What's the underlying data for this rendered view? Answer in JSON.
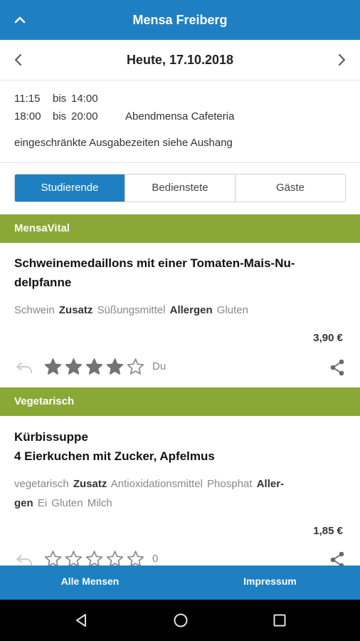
{
  "header": {
    "title": "Mensa Freiberg",
    "collapse_icon": "chevron-up-icon"
  },
  "datebar": {
    "date": "Heute, 17.10.2018",
    "prev_icon": "chevron-left-icon",
    "next_icon": "chevron-right-icon"
  },
  "hours": {
    "rows": [
      {
        "from": "11:15",
        "sep": "bis",
        "to": "14:00",
        "label": ""
      },
      {
        "from": "18:00",
        "sep": "bis",
        "to": "20:00",
        "label": "Abendmensa Cafeteria"
      }
    ],
    "notice": "eingeschränkte Ausgabezeiten siehe Aushang"
  },
  "tabs": [
    {
      "label": "Studierende",
      "active": true
    },
    {
      "label": "Bedienstete",
      "active": false
    },
    {
      "label": "Gäste",
      "active": false
    }
  ],
  "meals": [
    {
      "category": "MensaVital",
      "title_lines": [
        "Schweinemedaillons mit einer Tomaten-Mais-Nu-",
        "delpfanne"
      ],
      "tag_lines": [
        [
          {
            "text": "Schwein",
            "bold": false
          },
          {
            "text": "Zusatz",
            "bold": true
          },
          {
            "text": "Süßungsmittel",
            "bold": false
          },
          {
            "text": "Allergen",
            "bold": true
          },
          {
            "text": "Gluten",
            "bold": false
          }
        ]
      ],
      "price": "3,90 €",
      "rating": {
        "stars": 4,
        "max": 5,
        "label": "Du"
      }
    },
    {
      "category": "Vegetarisch",
      "title_lines": [
        "Kürbissuppe",
        "4 Eierkuchen mit Zucker, Apfelmus"
      ],
      "tag_lines": [
        [
          {
            "text": "vegetarisch",
            "bold": false
          },
          {
            "text": "Zusatz",
            "bold": true
          },
          {
            "text": "Antioxidationsmittel",
            "bold": false
          },
          {
            "text": "Phosphat",
            "bold": false
          },
          {
            "text": "Aller-",
            "bold": true
          }
        ],
        [
          {
            "text": "gen",
            "bold": true
          },
          {
            "text": "Ei",
            "bold": false
          },
          {
            "text": "Gluten",
            "bold": false
          },
          {
            "text": "Milch",
            "bold": false
          }
        ]
      ],
      "price": "1,85 €",
      "rating": {
        "stars": 0,
        "max": 5,
        "label": "0"
      }
    }
  ],
  "bottom_nav": {
    "left": "Alle Mensen",
    "right": "Impressum"
  },
  "colors": {
    "primary": "#1e80c2",
    "category": "#8aa836"
  }
}
